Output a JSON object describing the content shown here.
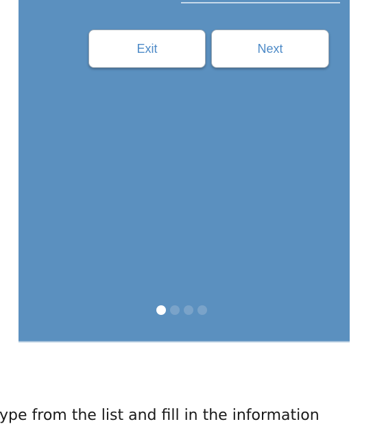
{
  "buttons": {
    "exit_label": "Exit",
    "next_label": "Next"
  },
  "pager": {
    "total_pages": 4,
    "current_page": 1
  },
  "caption": {
    "text": "ype from the list and fill in the information"
  },
  "colors": {
    "panel_background": "#5b90bf",
    "button_text": "#4d8ac7",
    "active_dot": "#ffffff",
    "inactive_dot": "#7aa3c9"
  }
}
